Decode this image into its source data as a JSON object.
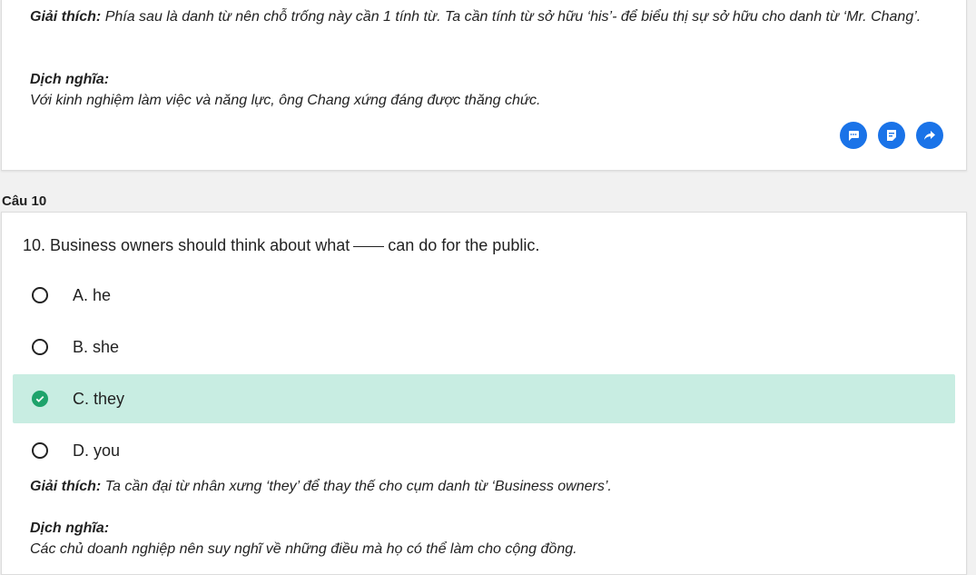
{
  "prev_explanation": {
    "giai_thich_label": "Giải thích:",
    "giai_thich_text": "Phía sau là danh từ nên chỗ trống này cần 1 tính từ. Ta cần tính từ sở hữu ‘his’- để biểu thị sự sở hữu cho danh từ ‘Mr. Chang’.",
    "dich_nghia_label": "Dịch nghĩa:",
    "dich_nghia_text": "Với kinh nghiệm làm việc và năng lực, ông Chang xứng đáng được thăng chức."
  },
  "actions": {
    "comment_icon": "comment-icon",
    "note_icon": "note-icon",
    "share_icon": "share-icon",
    "accent_color": "#1a73e8"
  },
  "question": {
    "number_label": "Câu 10",
    "text_before": "10. Business owners should think about what",
    "text_after": "can do for the public.",
    "options": [
      {
        "label": "A. he",
        "state": "unselected"
      },
      {
        "label": "B. she",
        "state": "unselected"
      },
      {
        "label": "C. they",
        "state": "correct"
      },
      {
        "label": "D. you",
        "state": "unselected"
      }
    ],
    "correct_color": "#c8ede2",
    "check_color": "#1ea36b"
  },
  "explanation": {
    "giai_thich_label": "Giải thích:",
    "giai_thich_text": "Ta cần đại từ nhân xưng ‘they’ để thay thế cho cụm danh từ ‘Business owners’.",
    "dich_nghia_label": "Dịch nghĩa:",
    "dich_nghia_text": "Các chủ doanh nghiệp nên suy nghĩ về những điều mà họ có thể làm cho cộng đồng."
  }
}
